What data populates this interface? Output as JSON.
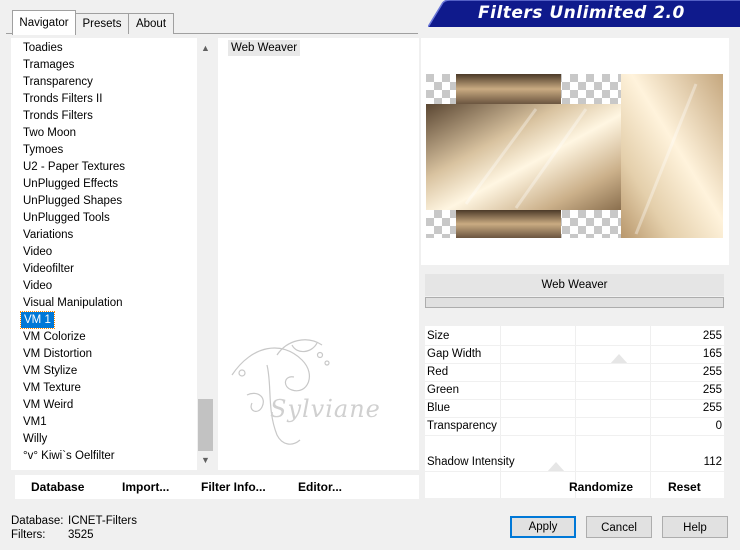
{
  "tabs": [
    "Navigator",
    "Presets",
    "About"
  ],
  "banner_title": "Filters Unlimited 2.0",
  "categories": [
    "Toadies",
    "Tramages",
    "Transparency",
    "Tronds Filters II",
    "Tronds Filters",
    "Two Moon",
    "Tymoes",
    "U2 - Paper Textures",
    "UnPlugged Effects",
    "UnPlugged Shapes",
    "UnPlugged Tools",
    "Variations",
    "Video",
    "Videofilter",
    "Video",
    "Visual Manipulation",
    "VM 1",
    "VM Colorize",
    "VM Distortion",
    "VM Stylize",
    "VM Texture",
    "VM Weird",
    "VM1",
    "Willy",
    "°v° Kiwi`s Oelfilter"
  ],
  "selected_category": "VM 1",
  "filters": [
    "Web Weaver"
  ],
  "watermark": "Sylviane",
  "filter_title": "Web Weaver",
  "params": [
    {
      "label": "Size",
      "value": "255"
    },
    {
      "label": "Gap Width",
      "value": "165"
    },
    {
      "label": "Red",
      "value": "255"
    },
    {
      "label": "Green",
      "value": "255"
    },
    {
      "label": "Blue",
      "value": "255"
    },
    {
      "label": "Transparency",
      "value": "0"
    },
    {
      "label": "Shadow Intensity",
      "value": "112"
    }
  ],
  "left_buttons": {
    "database": "Database",
    "import": "Import...",
    "filter_info": "Filter Info...",
    "editor": "Editor..."
  },
  "right_buttons": {
    "randomize": "Randomize",
    "reset": "Reset"
  },
  "footer": {
    "database_label": "Database:",
    "database_value": "ICNET-Filters",
    "filters_label": "Filters:",
    "filters_value": "3525"
  },
  "dialog_buttons": {
    "apply": "Apply",
    "cancel": "Cancel",
    "help": "Help"
  },
  "colors": {
    "banner": "#0f1a8c",
    "selection": "#0078d7"
  }
}
